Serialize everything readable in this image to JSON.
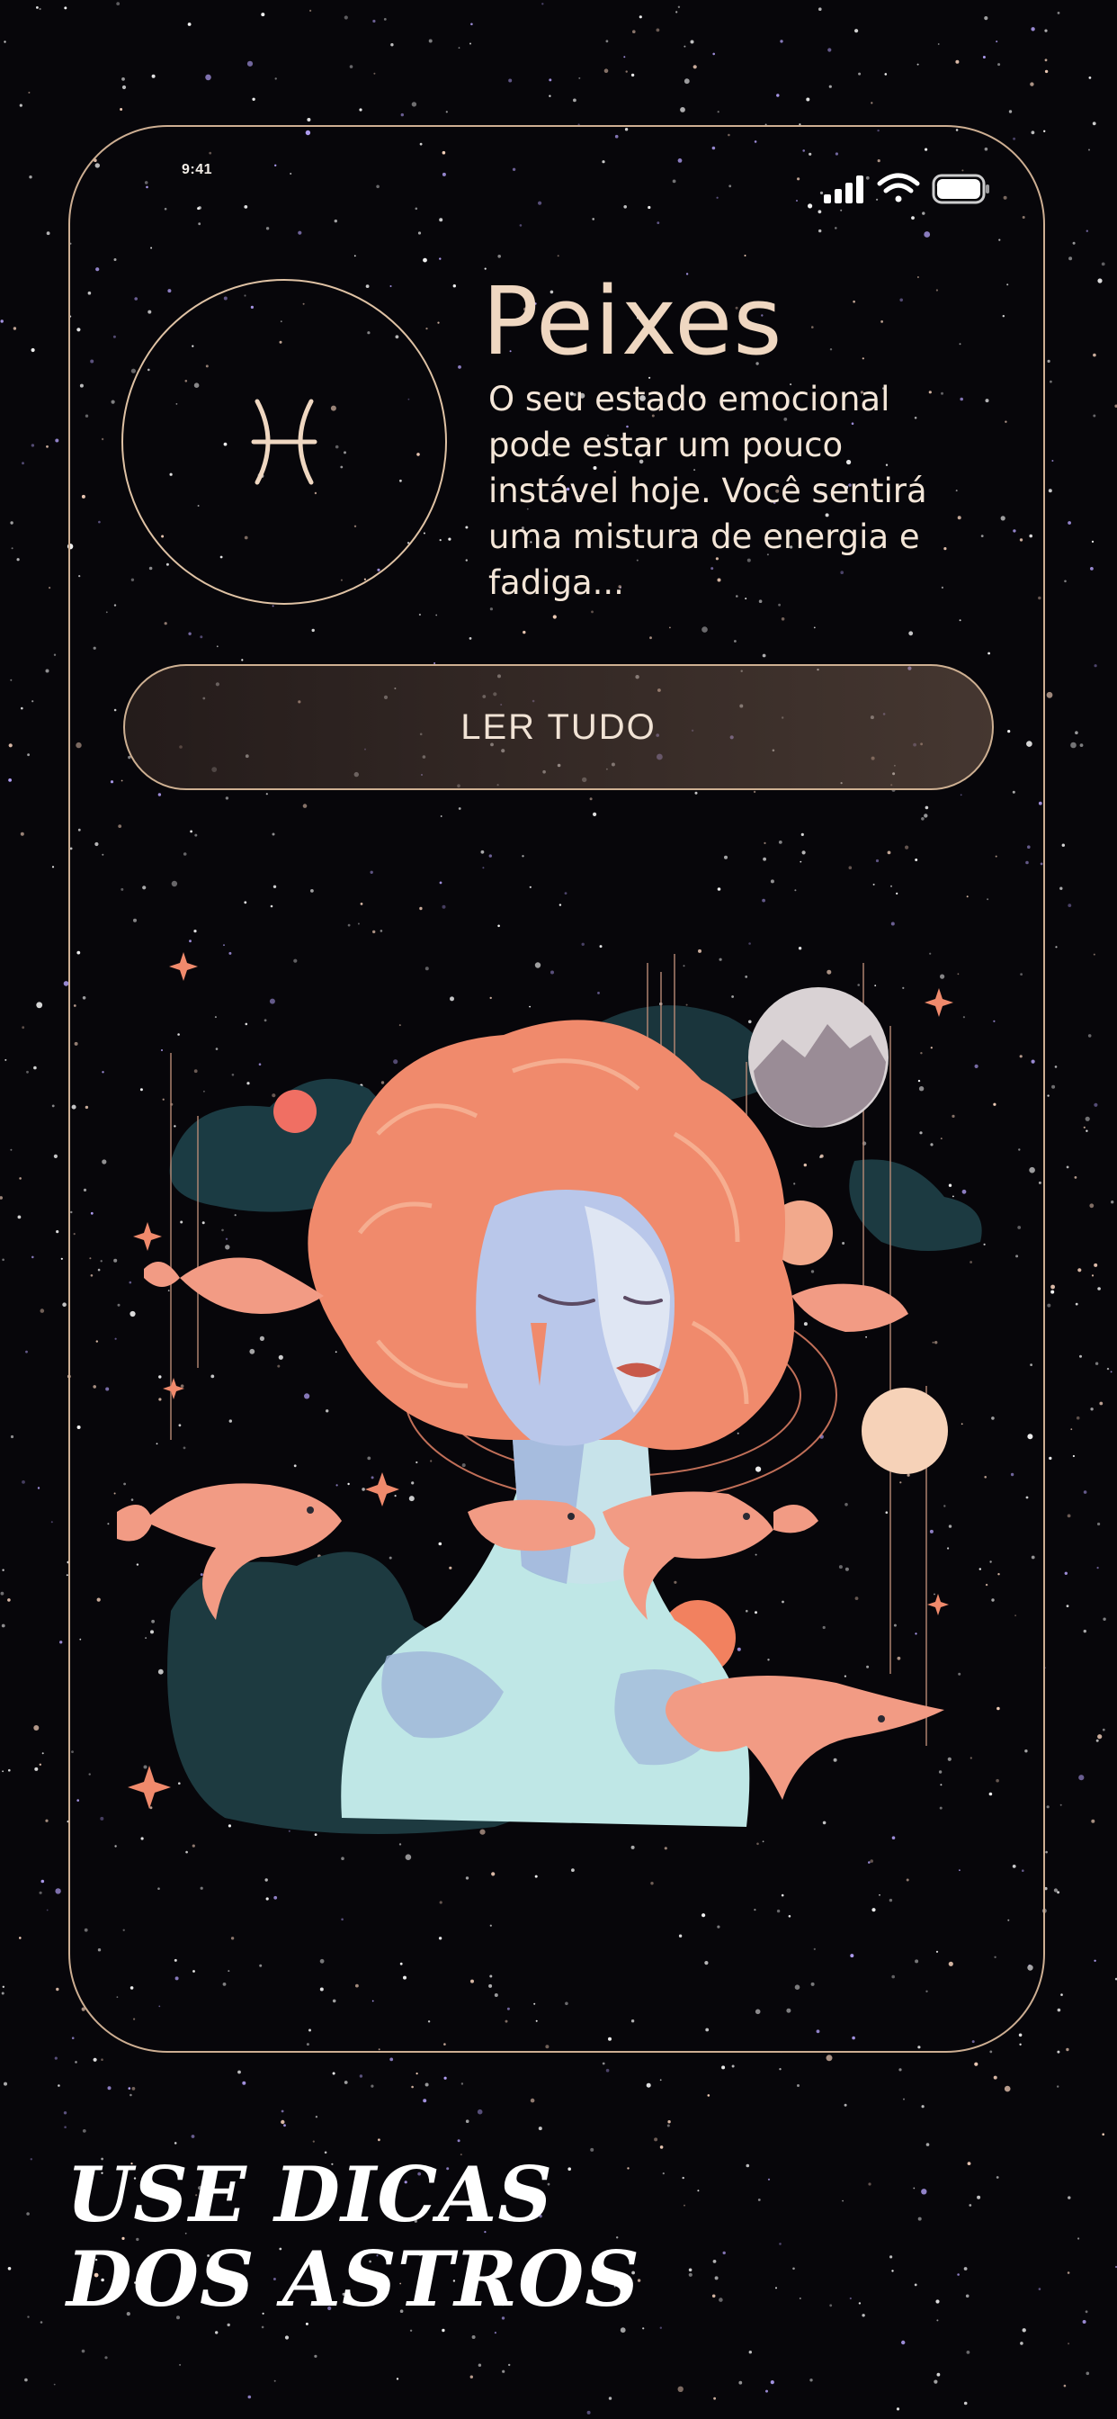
{
  "status_bar": {
    "time": "9:41",
    "icons": [
      "cellular-signal-icon",
      "wifi-icon",
      "battery-icon"
    ]
  },
  "horoscope": {
    "sign_name": "Peixes",
    "sign_symbol": "♓",
    "sign_icon": "pisces-icon",
    "summary": "O seu estado emocional pode estar um pouco instável hoje. Você sentirá uma mistura de energia e fadiga...",
    "read_more_label": "LER TUDO"
  },
  "headline": {
    "line1": "USE DICAS",
    "line2": "DOS ASTROS"
  },
  "colors": {
    "background": "#07060a",
    "frame_border": "#cdae92",
    "accent_coral": "#f08a6c",
    "text_light": "#f4e6d8"
  }
}
